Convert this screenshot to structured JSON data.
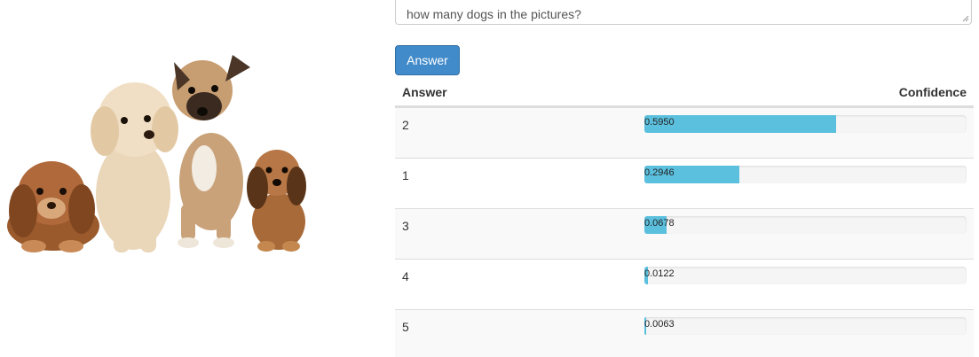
{
  "image": {
    "subject": "four puppies"
  },
  "question": {
    "value": "how many dogs in the pictures?"
  },
  "answer_button": {
    "label": "Answer",
    "color": "#428bca"
  },
  "results_table": {
    "headers": {
      "answer": "Answer",
      "confidence": "Confidence"
    },
    "bar_color": "#5bc0de",
    "rows": [
      {
        "answer": "2",
        "confidence": 0.595,
        "confidence_text": "0.5950"
      },
      {
        "answer": "1",
        "confidence": 0.2946,
        "confidence_text": "0.2946"
      },
      {
        "answer": "3",
        "confidence": 0.0678,
        "confidence_text": "0.0678"
      },
      {
        "answer": "4",
        "confidence": 0.0122,
        "confidence_text": "0.0122"
      },
      {
        "answer": "5",
        "confidence": 0.0063,
        "confidence_text": "0.0063"
      }
    ]
  }
}
